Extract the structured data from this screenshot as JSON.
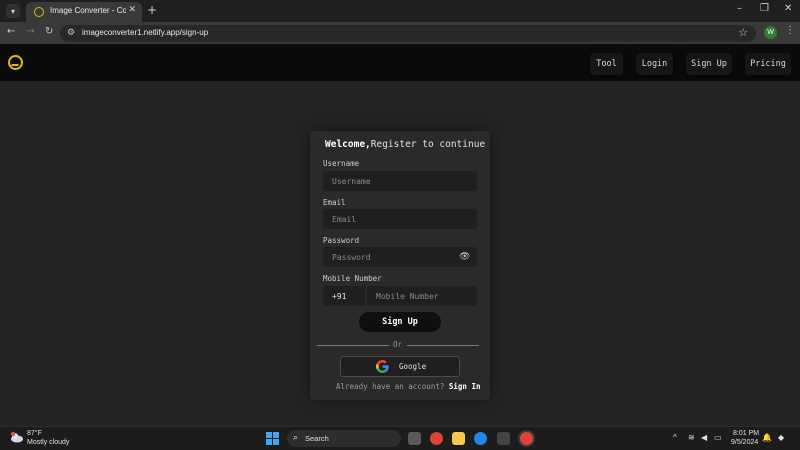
{
  "browser": {
    "tab_title": "Image Converter - Convert Ima",
    "tab_close": "✕",
    "new_tab": "+",
    "url": "imageconverter1.netlify.app/sign-up",
    "window_controls": [
      "–",
      "❐",
      "✕"
    ],
    "extension_badge": "W"
  },
  "navbar": {
    "links": [
      "Tool",
      "Login",
      "Sign Up",
      "Pricing"
    ],
    "accent_color": "#e2b714"
  },
  "form": {
    "welcome_bold": "Welcome,",
    "welcome_rest": "Register to continue",
    "username_label": "Username",
    "username_placeholder": "Username",
    "email_label": "Email",
    "email_placeholder": "Email",
    "password_label": "Password",
    "password_placeholder": "Password",
    "mobile_label": "Mobile Number",
    "country_code": "+91",
    "mobile_placeholder": "Mobile Number",
    "signup_button": "Sign Up",
    "or_text": "Or",
    "google_button": "Google",
    "already_text": "Already have an account?",
    "signin_link": "Sign In"
  },
  "taskbar": {
    "weather_temp": "87°F",
    "weather_desc": "Mostly cloudy",
    "search_label": "Search",
    "time": "8:01 PM",
    "date": "9/5/2024"
  },
  "icons": {
    "eye": "eye-icon",
    "google": "google-icon",
    "logo": "app-logo-icon"
  }
}
